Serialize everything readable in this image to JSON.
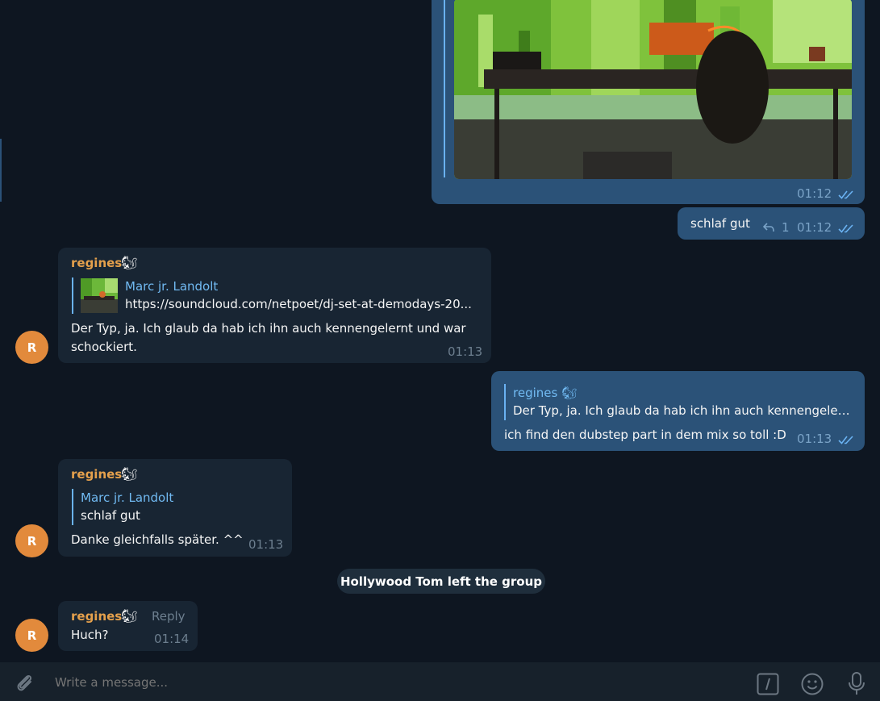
{
  "app": "Telegram Desktop",
  "messages": {
    "photo": {
      "time": "01:12"
    },
    "schlaf": {
      "text": "schlaf gut",
      "reply_count": "1",
      "time": "01:12"
    },
    "regines1": {
      "sender": "regines",
      "quote_author": "Marc jr. Landolt",
      "quote_text": "https://soundcloud.com/netpoet/dj-set-at-demodays-20...",
      "line1": "Der Typ, ja. Ich glaub da hab ich ihn auch kennengelernt und war",
      "line2": "schockiert.",
      "time": "01:13",
      "avatar": "R"
    },
    "reply_out": {
      "quote_author": "regines",
      "quote_text": "Der Typ, ja. Ich glaub da hab ich ihn auch kennengeler...",
      "text": "ich find den dubstep part in dem mix so toll :D",
      "time": "01:13"
    },
    "regines2": {
      "sender": "regines",
      "quote_author": "Marc jr. Landolt",
      "quote_text": "schlaf gut",
      "text": "Danke gleichfalls später. ^^",
      "time": "01:13",
      "avatar": "R"
    },
    "service": {
      "text": "Hollywood Tom left the group"
    },
    "regines3": {
      "sender": "regines",
      "reply_label": "Reply",
      "text": "Huch?",
      "time": "01:14",
      "avatar": "R"
    }
  },
  "composer": {
    "placeholder": "Write a message..."
  },
  "icons": {
    "attach": "paperclip-icon",
    "commands": "slash-command-icon",
    "emoji": "smiley-icon",
    "voice": "microphone-icon",
    "sender_emoji": "squirrel-icon"
  },
  "colors": {
    "background": "#0e1621",
    "outgoing_bubble": "#2b5278",
    "incoming_bubble": "#182533",
    "sender_name": "#e4a04c",
    "link_blue": "#71baf2",
    "avatar": "#e28a3c"
  }
}
